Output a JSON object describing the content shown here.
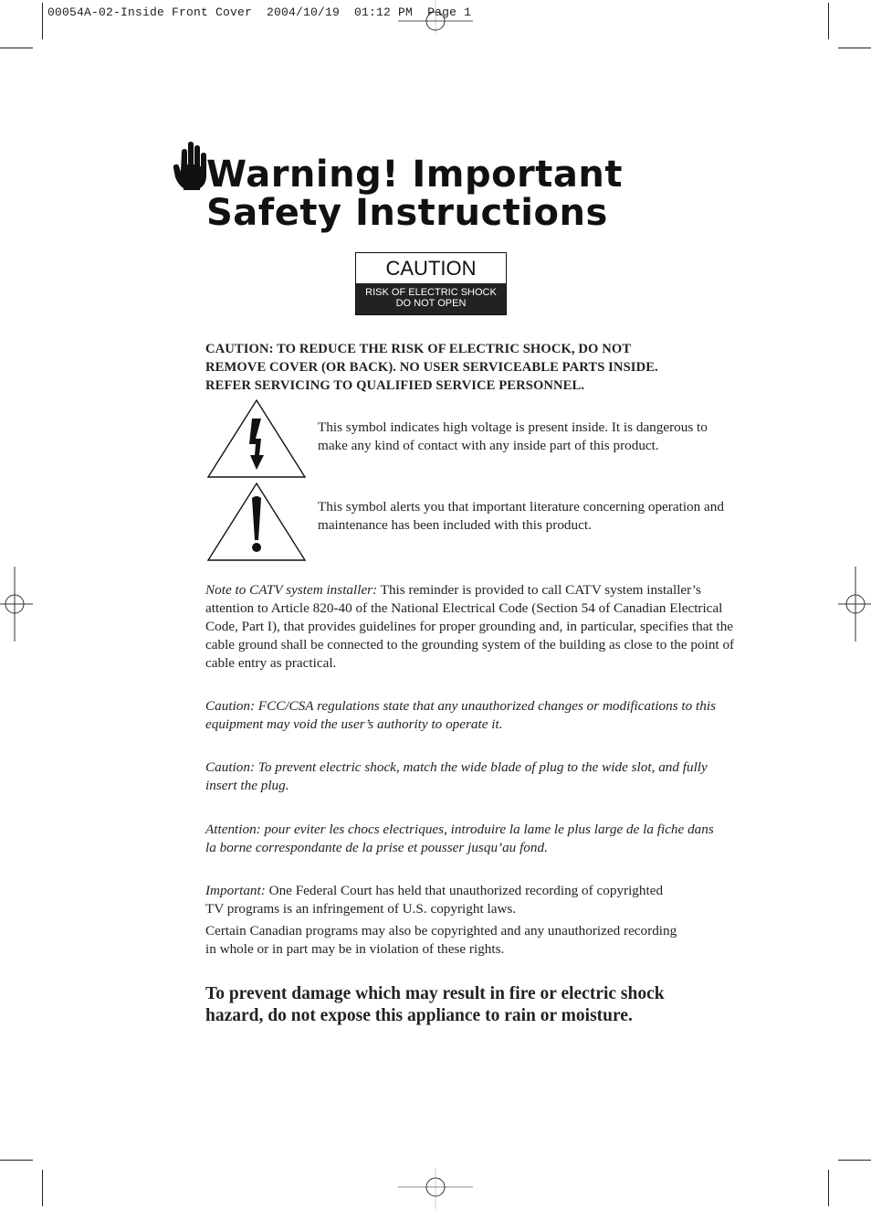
{
  "slug": {
    "text": "00054A-02-Inside Front Cover  2004/10/19  01:12 PM  Page 1"
  },
  "title": {
    "line1": "Warning! Important",
    "line2": "Safety Instructions",
    "icon": "hand-stop-icon"
  },
  "caution_label": {
    "heading": "CAUTION",
    "line1": "RISK OF ELECTRIC SHOCK",
    "line2": "DO NOT OPEN"
  },
  "caution_caps": {
    "line1": "CAUTION: TO REDUCE THE RISK OF ELECTRIC SHOCK, DO NOT",
    "line2": "REMOVE COVER (OR BACK). NO USER SERVICEABLE PARTS INSIDE.",
    "line3": "REFER SERVICING TO QUALIFIED SERVICE PERSONNEL."
  },
  "symbols": [
    {
      "icon": "high-voltage-warning-icon",
      "text": "This symbol indicates high voltage is present inside. It is dangerous to make any kind of contact with any inside part of this product."
    },
    {
      "icon": "exclamation-warning-icon",
      "text": "This symbol alerts you that important literature concerning operation and maintenance has been included with this product."
    }
  ],
  "catv_note": {
    "label": "Note to CATV system installer:",
    "text": " This reminder is provided to call CATV system installer’s attention to Article 820-40 of the National Electrical Code (Section 54 of Canadian Electrical Code, Part I), that provides guidelines for proper grounding and, in particular, specifies that the cable ground shall be connected to the grounding system of the building as close to the point of cable entry as practical."
  },
  "fcc_caution": "Caution: FCC/CSA regulations state that any unauthorized changes or modifications to this equipment may void the user’s authority to operate it.",
  "plug_caution": "Caution: To prevent electric shock, match the wide blade of plug to the wide slot, and fully insert the plug.",
  "french_attention": "Attention: pour eviter les chocs electriques, introduire la lame le plus large de la fiche dans la borne correspondante de la prise et pousser jusqu’au fond.",
  "important": {
    "label": "Important:",
    "text": " One Federal Court has held that unauthorized recording of copyrighted TV programs is an infringement of U.S. copyright laws.",
    "text2": "Certain Canadian programs may also be copyrighted and any unauthorized recording in whole or in part may be in violation of these rights."
  },
  "final_warning": "To prevent damage which may result in fire or electric shock hazard, do not expose this appliance to rain or moisture."
}
